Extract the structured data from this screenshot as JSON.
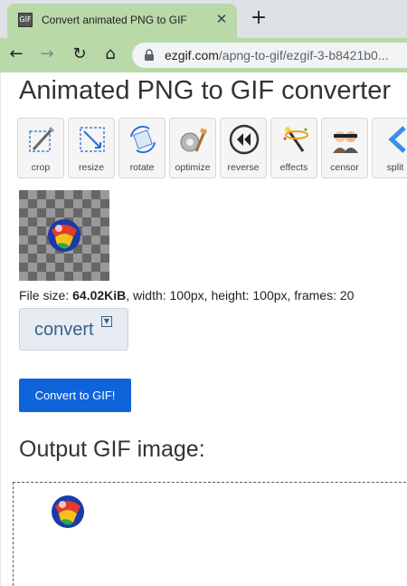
{
  "browser": {
    "tab_title": "Convert animated PNG to GIF",
    "favicon_text": "GIF",
    "tab_close": "✕",
    "new_tab": "+",
    "url_host": "ezgif.com",
    "url_path": "/apng-to-gif/ezgif-3-b8421b0..."
  },
  "nav": {
    "back": "←",
    "forward": "→",
    "reload": "↻",
    "home": "⌂"
  },
  "page": {
    "title": "Animated PNG to GIF converter",
    "tools": [
      {
        "label": "crop",
        "icon": "crop-icon"
      },
      {
        "label": "resize",
        "icon": "resize-icon"
      },
      {
        "label": "rotate",
        "icon": "rotate-icon"
      },
      {
        "label": "optimize",
        "icon": "optimize-icon"
      },
      {
        "label": "reverse",
        "icon": "reverse-icon"
      },
      {
        "label": "effects",
        "icon": "effects-icon"
      },
      {
        "label": "censor",
        "icon": "censor-icon"
      },
      {
        "label": "split",
        "icon": "split-icon"
      }
    ],
    "file_info": {
      "prefix": "File size: ",
      "size": "64.02KiB",
      "rest": ", width: 100px, height: 100px, frames: 20"
    },
    "convert_select": {
      "label": "convert",
      "dropdown_icon": "▼"
    },
    "convert_button": "Convert to GIF!",
    "output_title": "Output GIF image:"
  },
  "colors": {
    "tab_active": "#b9d9a8",
    "primary_button": "#1064d9"
  }
}
